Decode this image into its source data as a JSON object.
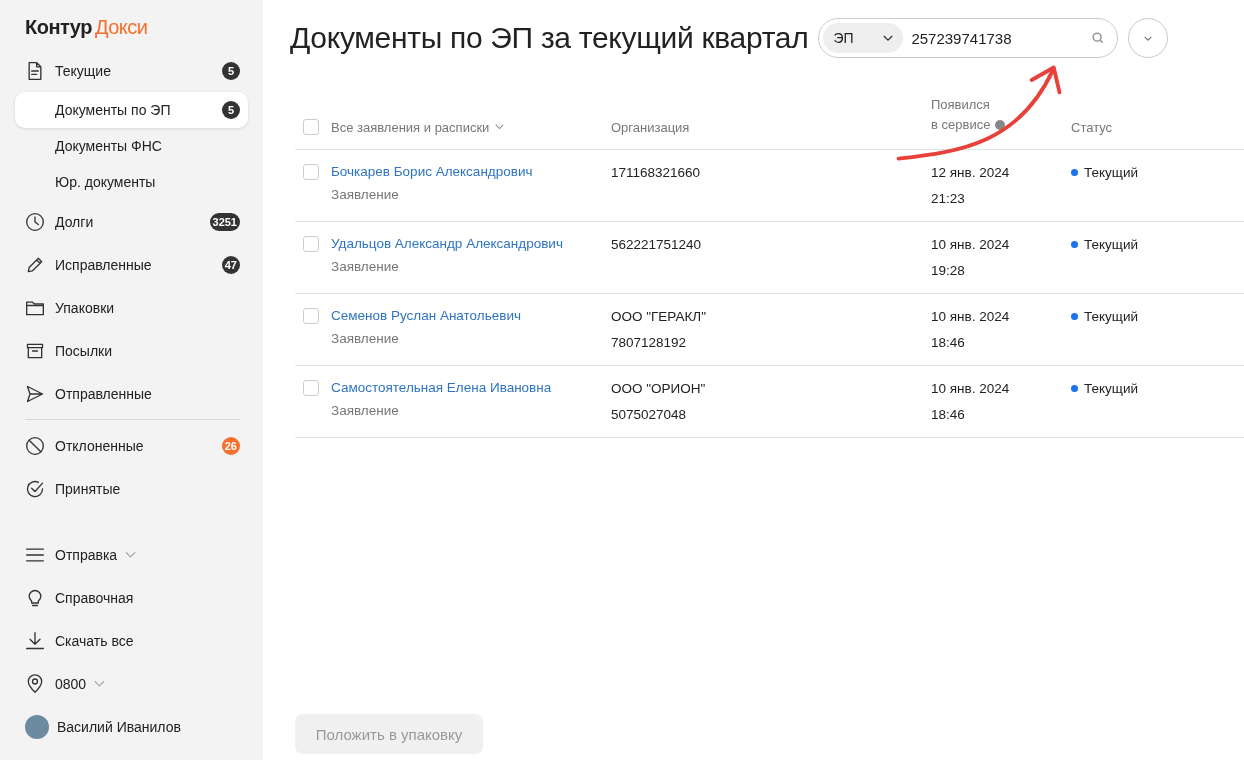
{
  "logo": {
    "brand": "Контур",
    "product": "Докси"
  },
  "nav_groups": [
    [
      {
        "label": "Текущие",
        "badge": {
          "text": "5",
          "color": "#333333"
        },
        "selected": false,
        "children": [
          {
            "label": "Документы по ЭП",
            "badge": {
              "text": "5",
              "color": "#333333"
            },
            "selected": true
          },
          {
            "label": "Документы ФНС",
            "selected": false
          },
          {
            "label": "Юр. документы",
            "selected": false
          }
        ]
      },
      {
        "label": "Долги",
        "badge": {
          "text": "3251",
          "color": "#333333"
        },
        "selected": false
      },
      {
        "label": "Исправленные",
        "badge": {
          "text": "47",
          "color": "#333333"
        },
        "selected": false
      },
      {
        "label": "Упаковки",
        "selected": false
      },
      {
        "label": "Посылки",
        "selected": false
      },
      {
        "label": "Отправленные",
        "selected": false
      }
    ],
    [
      {
        "label": "Отклоненные",
        "badge": {
          "text": "26",
          "color": "#f66f2c"
        },
        "selected": false
      },
      {
        "label": "Принятые",
        "selected": false
      }
    ]
  ],
  "bottom_items": [
    {
      "label": "Отправка",
      "has_menu": true
    },
    {
      "label": "Справочная",
      "has_menu": false
    },
    {
      "label": "Скачать все",
      "has_menu": false
    },
    {
      "label": "0800",
      "has_menu": true
    }
  ],
  "user": {
    "name": "Василий Иванилов"
  },
  "header": {
    "title": "Документы по ЭП за текущий квартал",
    "search": {
      "scope": "ЭП",
      "value": "257239741738"
    }
  },
  "table": {
    "all_checked": false,
    "columns": [
      {
        "label": "Все заявления и расписки",
        "kind": "filter"
      },
      {
        "label": "Организация"
      },
      {
        "label": "Появился в сервисе",
        "kind": "help"
      },
      {
        "label": "Статус"
      }
    ],
    "rows": [
      {
        "checked": false,
        "name": "Бочкарев Борис Александрович",
        "doc_type": "Заявление",
        "org": [
          "171168321660"
        ],
        "date": "12 янв. 2024",
        "time": "21:23",
        "status": "Текущий"
      },
      {
        "checked": false,
        "name": "Удальцов Александр Александрович",
        "doc_type": "Заявление",
        "org": [
          "562221751240"
        ],
        "date": "10 янв. 2024",
        "time": "19:28",
        "status": "Текущий"
      },
      {
        "checked": false,
        "name": "Семенов Руслан Анатольевич",
        "doc_type": "Заявление",
        "org": [
          "ООО \"ГЕРАКЛ\"",
          "7807128192"
        ],
        "date": "10 янв. 2024",
        "time": "18:46",
        "status": "Текущий"
      },
      {
        "checked": false,
        "name": "Самостоятельная Елена Ивановна",
        "doc_type": "Заявление",
        "org": [
          "ООО \"ОРИОН\"",
          "5075027048"
        ],
        "date": "10 янв. 2024",
        "time": "18:46",
        "status": "Текущий"
      }
    ]
  },
  "action_button": {
    "label": "Положить в упаковку",
    "disabled": true
  }
}
